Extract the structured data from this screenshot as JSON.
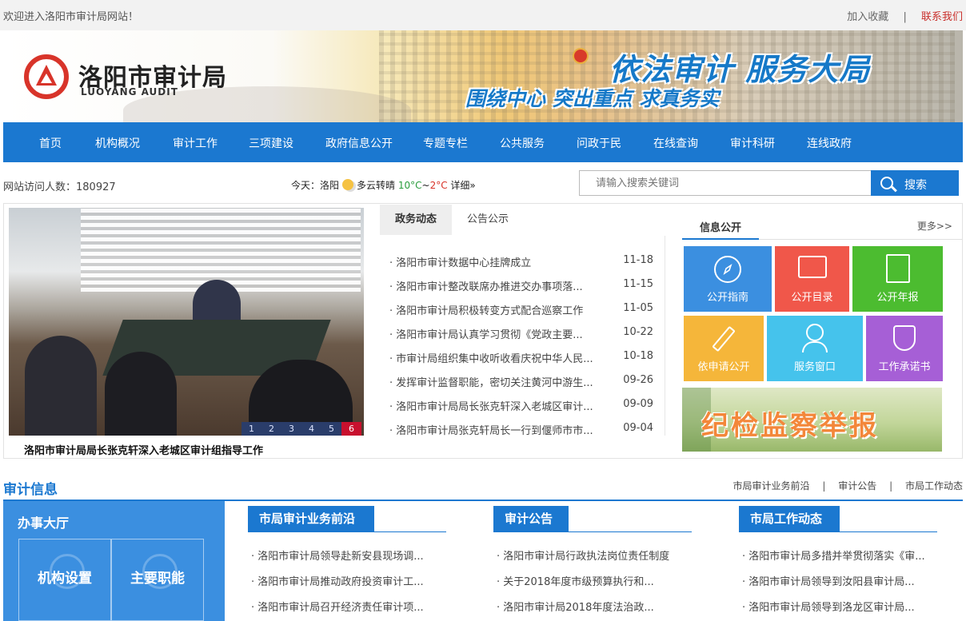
{
  "topbar": {
    "welcome": "欢迎进入洛阳市审计局网站！",
    "favorite": "加入收藏",
    "separator": "|",
    "contact": "联系我们"
  },
  "banner": {
    "name_cn": "洛阳市审计局",
    "name_en": "LUOYANG AUDIT",
    "slogan_main": "依法审计  服务大局",
    "slogan_sub": "围绕中心 突出重点 求真务实"
  },
  "nav": {
    "items": [
      "首页",
      "机构概况",
      "审计工作",
      "三项建设",
      "政府信息公开",
      "专题专栏",
      "公共服务",
      "问政于民",
      "在线查询",
      "审计科研",
      "连线政府"
    ]
  },
  "info_row": {
    "visitors": "网站访问人数：180927",
    "weather_prefix": "今天：洛阳",
    "weather_desc": "多云转晴",
    "temp_low": "10°C",
    "temp_sep": "~",
    "temp_high": "2°C",
    "weather_detail": "详细»",
    "search_placeholder": "请输入搜索关键词",
    "search_button": "搜索"
  },
  "slider": {
    "caption": "洛阳市审计局局长张克轩深入老城区审计组指导工作",
    "pages": [
      "1",
      "2",
      "3",
      "4",
      "5",
      "6"
    ],
    "active_page": 6
  },
  "news": {
    "tabs": [
      "政务动态",
      "公告公示"
    ],
    "items": [
      {
        "title": "洛阳市审计数据中心挂牌成立",
        "date": "11-18"
      },
      {
        "title": "洛阳市审计整改联席办推进交办事项落...",
        "date": "11-15"
      },
      {
        "title": "洛阳市审计局积极转变方式配合巡察工作",
        "date": "11-05"
      },
      {
        "title": "洛阳市审计局认真学习贯彻《党政主要...",
        "date": "10-22"
      },
      {
        "title": "市审计局组织集中收听收看庆祝中华人民...",
        "date": "10-18"
      },
      {
        "title": "发挥审计监督职能，密切关注黄河中游生...",
        "date": "09-26"
      },
      {
        "title": "洛阳市审计局局长张克轩深入老城区审计...",
        "date": "09-09"
      },
      {
        "title": "洛阳市审计局张克轩局长一行到偃师市市...",
        "date": "09-04"
      }
    ]
  },
  "info_open": {
    "title": "信息公开",
    "more": "更多>>",
    "tiles": [
      {
        "label": "公开指南",
        "color": "#3b8fe0",
        "icon": "compass-icon"
      },
      {
        "label": "公开目录",
        "color": "#f0574a",
        "icon": "monitor-icon"
      },
      {
        "label": "公开年报",
        "color": "#4cbc30",
        "icon": "document-icon"
      },
      {
        "label": "依申请公开",
        "color": "#f5b63a",
        "icon": "pencil-icon"
      },
      {
        "label": "服务窗口",
        "color": "#45c3ec",
        "icon": "person-icon"
      },
      {
        "label": "工作承诺书",
        "color": "#a65fd6",
        "icon": "shield-icon"
      }
    ],
    "report_banner": "纪检监察举报"
  },
  "audit_info": {
    "title": "审计信息",
    "links": [
      "市局审计业务前沿",
      "审计公告",
      "市局工作动态"
    ],
    "link_sep": "|",
    "hall": {
      "title": "办事大厅",
      "boxes": [
        "机构设置",
        "主要职能"
      ]
    },
    "columns": [
      {
        "head": "市局审计业务前沿",
        "items": [
          "洛阳市审计局领导赴新安县现场调...",
          "洛阳市审计局推动政府投资审计工...",
          "洛阳市审计局召开经济责任审计项..."
        ]
      },
      {
        "head": "审计公告",
        "items": [
          "洛阳市审计局行政执法岗位责任制度",
          "关于2018年度市级预算执行和...",
          "洛阳市审计局2018年度法治政..."
        ]
      },
      {
        "head": "市局工作动态",
        "items": [
          "洛阳市审计局多措并举贯彻落实《审...",
          "洛阳市审计局领导到汝阳县审计局...",
          "洛阳市审计局领导到洛龙区审计局..."
        ]
      }
    ]
  }
}
